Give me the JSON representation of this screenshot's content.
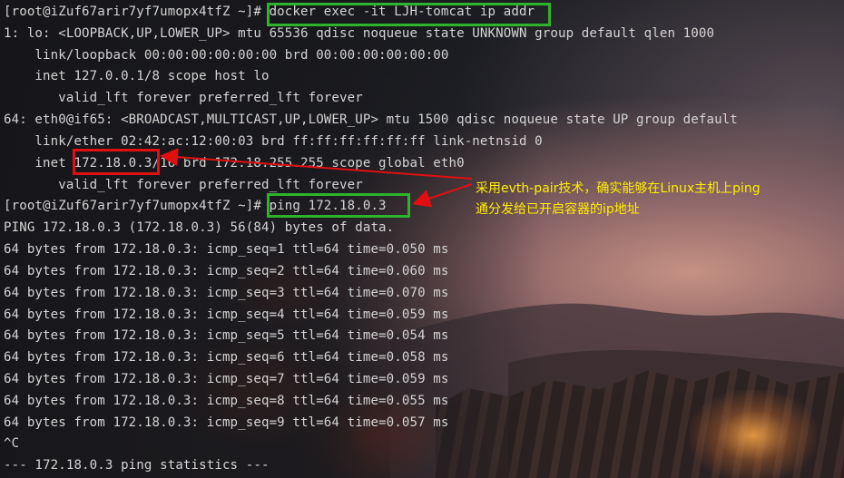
{
  "terminal": {
    "lines": [
      "[root@iZuf67arir7yf7umopx4tfZ ~]# docker exec -it LJH-tomcat ip addr",
      "1: lo: <LOOPBACK,UP,LOWER_UP> mtu 65536 qdisc noqueue state UNKNOWN group default qlen 1000",
      "    link/loopback 00:00:00:00:00:00 brd 00:00:00:00:00:00",
      "    inet 127.0.0.1/8 scope host lo",
      "       valid_lft forever preferred_lft forever",
      "64: eth0@if65: <BROADCAST,MULTICAST,UP,LOWER_UP> mtu 1500 qdisc noqueue state UP group default",
      "    link/ether 02:42:ac:12:00:03 brd ff:ff:ff:ff:ff:ff link-netnsid 0",
      "    inet 172.18.0.3/16 brd 172.18.255.255 scope global eth0",
      "       valid_lft forever preferred_lft forever",
      "[root@iZuf67arir7yf7umopx4tfZ ~]# ping 172.18.0.3",
      "PING 172.18.0.3 (172.18.0.3) 56(84) bytes of data.",
      "64 bytes from 172.18.0.3: icmp_seq=1 ttl=64 time=0.050 ms",
      "64 bytes from 172.18.0.3: icmp_seq=2 ttl=64 time=0.060 ms",
      "64 bytes from 172.18.0.3: icmp_seq=3 ttl=64 time=0.070 ms",
      "64 bytes from 172.18.0.3: icmp_seq=4 ttl=64 time=0.059 ms",
      "64 bytes from 172.18.0.3: icmp_seq=5 ttl=64 time=0.054 ms",
      "64 bytes from 172.18.0.3: icmp_seq=6 ttl=64 time=0.058 ms",
      "64 bytes from 172.18.0.3: icmp_seq=7 ttl=64 time=0.059 ms",
      "64 bytes from 172.18.0.3: icmp_seq=8 ttl=64 time=0.055 ms",
      "64 bytes from 172.18.0.3: icmp_seq=9 ttl=64 time=0.057 ms",
      "^C",
      "--- 172.18.0.3 ping statistics ---"
    ]
  },
  "annotation": {
    "line1": "采用evth-pair技术，确实能够在Linux主机上ping",
    "line2": "通分发给已开启容器的ip地址"
  },
  "colors": {
    "highlight_command": "#2db32d",
    "highlight_ip": "#e01010",
    "annotation_text": "#ffee00",
    "terminal_text": "#d4d4d4"
  }
}
